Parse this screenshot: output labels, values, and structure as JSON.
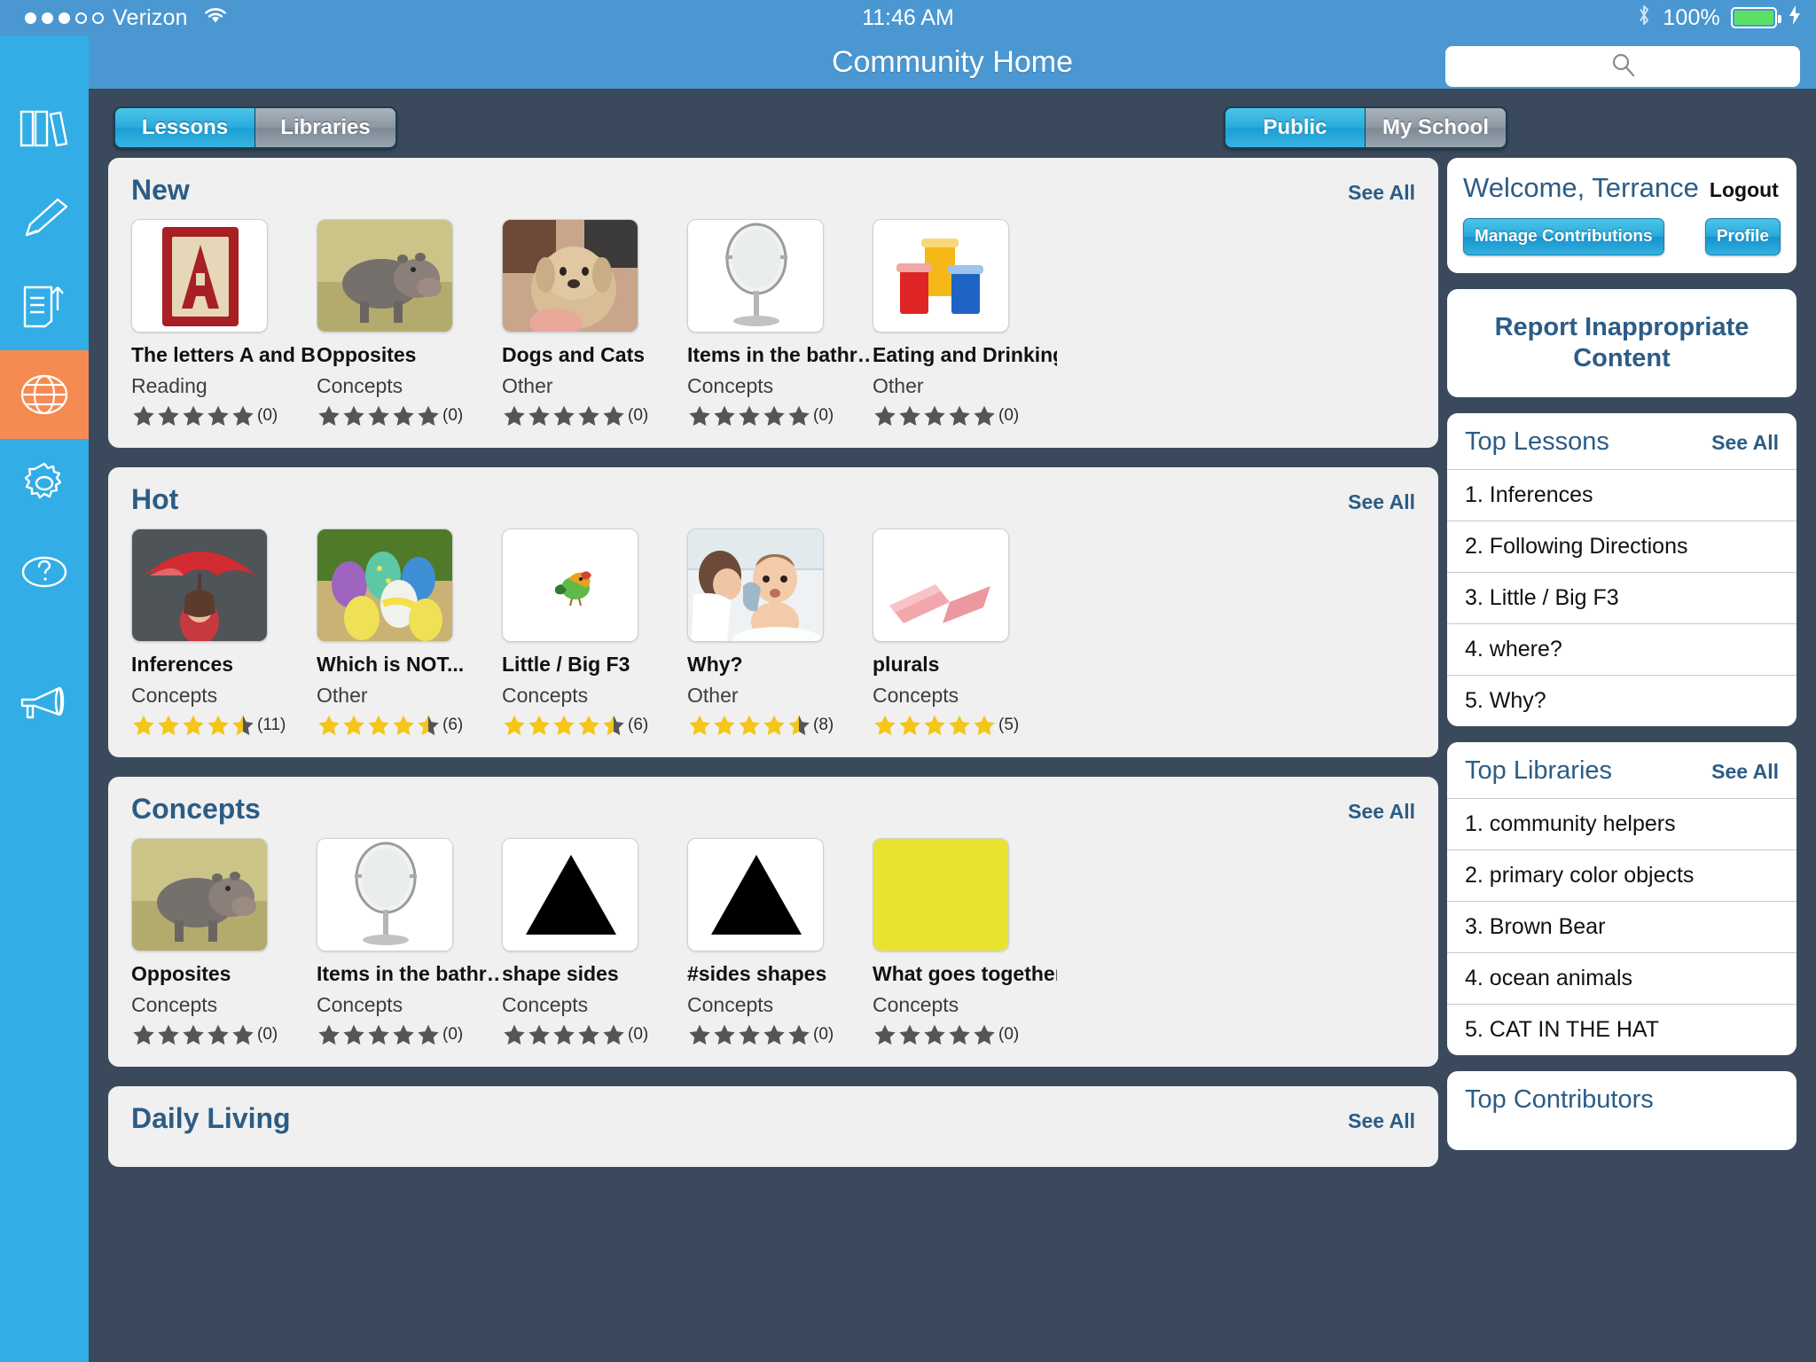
{
  "statusbar": {
    "carrier": "Verizon",
    "signal_filled": 3,
    "signal_total": 5,
    "time": "11:46 AM",
    "battery_percent": "100%",
    "battery_level": 100
  },
  "rail": {
    "items": [
      {
        "icon": "books-icon",
        "name": "library-books"
      },
      {
        "icon": "pencil-icon",
        "name": "create"
      },
      {
        "icon": "document-icon",
        "name": "lessons"
      },
      {
        "icon": "globe-icon",
        "name": "community",
        "active": true
      },
      {
        "icon": "gear-icon",
        "name": "settings"
      },
      {
        "icon": "question-icon",
        "name": "help"
      },
      {
        "icon": "megaphone-icon",
        "name": "announcements"
      }
    ]
  },
  "header": {
    "title": "Community Home",
    "search_placeholder": "",
    "search_value": ""
  },
  "toolbar": {
    "left_segment": {
      "options": [
        "Lessons",
        "Libraries"
      ],
      "selected": "Lessons"
    },
    "right_segment": {
      "options": [
        "Public",
        "My School"
      ],
      "selected": "Public"
    }
  },
  "sections": [
    {
      "title": "New",
      "see_all": "See All",
      "cards": [
        {
          "title": "The letters A and B",
          "category": "Reading",
          "rating": 0,
          "count": "(0)",
          "thumb": "letter-a-block"
        },
        {
          "title": "Opposites",
          "category": "Concepts",
          "rating": 0,
          "count": "(0)",
          "thumb": "hippo"
        },
        {
          "title": "Dogs and Cats",
          "category": "Other",
          "rating": 0,
          "count": "(0)",
          "thumb": "dog"
        },
        {
          "title": "Items in the bathr…",
          "category": "Concepts",
          "rating": 0,
          "count": "(0)",
          "thumb": "mirror"
        },
        {
          "title": "Eating and Drinking",
          "category": "Other",
          "rating": 0,
          "count": "(0)",
          "thumb": "cups"
        }
      ]
    },
    {
      "title": "Hot",
      "see_all": "See All",
      "cards": [
        {
          "title": "Inferences",
          "category": "Concepts",
          "rating": 4.5,
          "count": "(11)",
          "thumb": "umbrella"
        },
        {
          "title": "Which is NOT...",
          "category": "Other",
          "rating": 4.5,
          "count": "(6)",
          "thumb": "eggs"
        },
        {
          "title": "Little / Big F3",
          "category": "Concepts",
          "rating": 4.5,
          "count": "(6)",
          "thumb": "bird"
        },
        {
          "title": "Why?",
          "category": "Other",
          "rating": 4.5,
          "count": "(8)",
          "thumb": "baby-bath"
        },
        {
          "title": "plurals",
          "category": "Concepts",
          "rating": 5,
          "count": "(5)",
          "thumb": "erasers"
        }
      ]
    },
    {
      "title": "Concepts",
      "see_all": "See All",
      "cards": [
        {
          "title": "Opposites",
          "category": "Concepts",
          "rating": 0,
          "count": "(0)",
          "thumb": "hippo"
        },
        {
          "title": "Items in the bathr…",
          "category": "Concepts",
          "rating": 0,
          "count": "(0)",
          "thumb": "mirror"
        },
        {
          "title": "shape sides",
          "category": "Concepts",
          "rating": 0,
          "count": "(0)",
          "thumb": "triangle"
        },
        {
          "title": "#sides shapes",
          "category": "Concepts",
          "rating": 0,
          "count": "(0)",
          "thumb": "triangle"
        },
        {
          "title": "What goes together",
          "category": "Concepts",
          "rating": 0,
          "count": "(0)",
          "thumb": "yellow"
        }
      ]
    },
    {
      "title": "Daily Living",
      "see_all": "See All",
      "cards": []
    }
  ],
  "sidebar": {
    "welcome": {
      "greeting": "Welcome, Terrance",
      "logout": "Logout",
      "manage_label": "Manage Contributions",
      "profile_label": "Profile"
    },
    "report": "Report Inappropriate Content",
    "top_lessons": {
      "title": "Top Lessons",
      "see_all": "See All",
      "items": [
        "1. Inferences",
        "2. Following Directions",
        "3. Little / Big F3",
        "4. where?",
        "5. Why?"
      ]
    },
    "top_libraries": {
      "title": "Top Libraries",
      "see_all": "See All",
      "items": [
        "1. community helpers",
        "2. primary color objects",
        "3. Brown Bear",
        "4. ocean animals",
        "5. CAT IN THE HAT"
      ]
    },
    "top_contributors": {
      "title": "Top Contributors"
    }
  },
  "colors": {
    "accent_blue": "#32ade6",
    "header_blue": "#4a97d2",
    "active_orange": "#f58b52",
    "stage_dark": "#3a4a5c",
    "panel_gray": "#f0f0f0",
    "link_blue": "#2c5c86",
    "star_gold": "#f5c518",
    "star_gray": "#555555"
  }
}
